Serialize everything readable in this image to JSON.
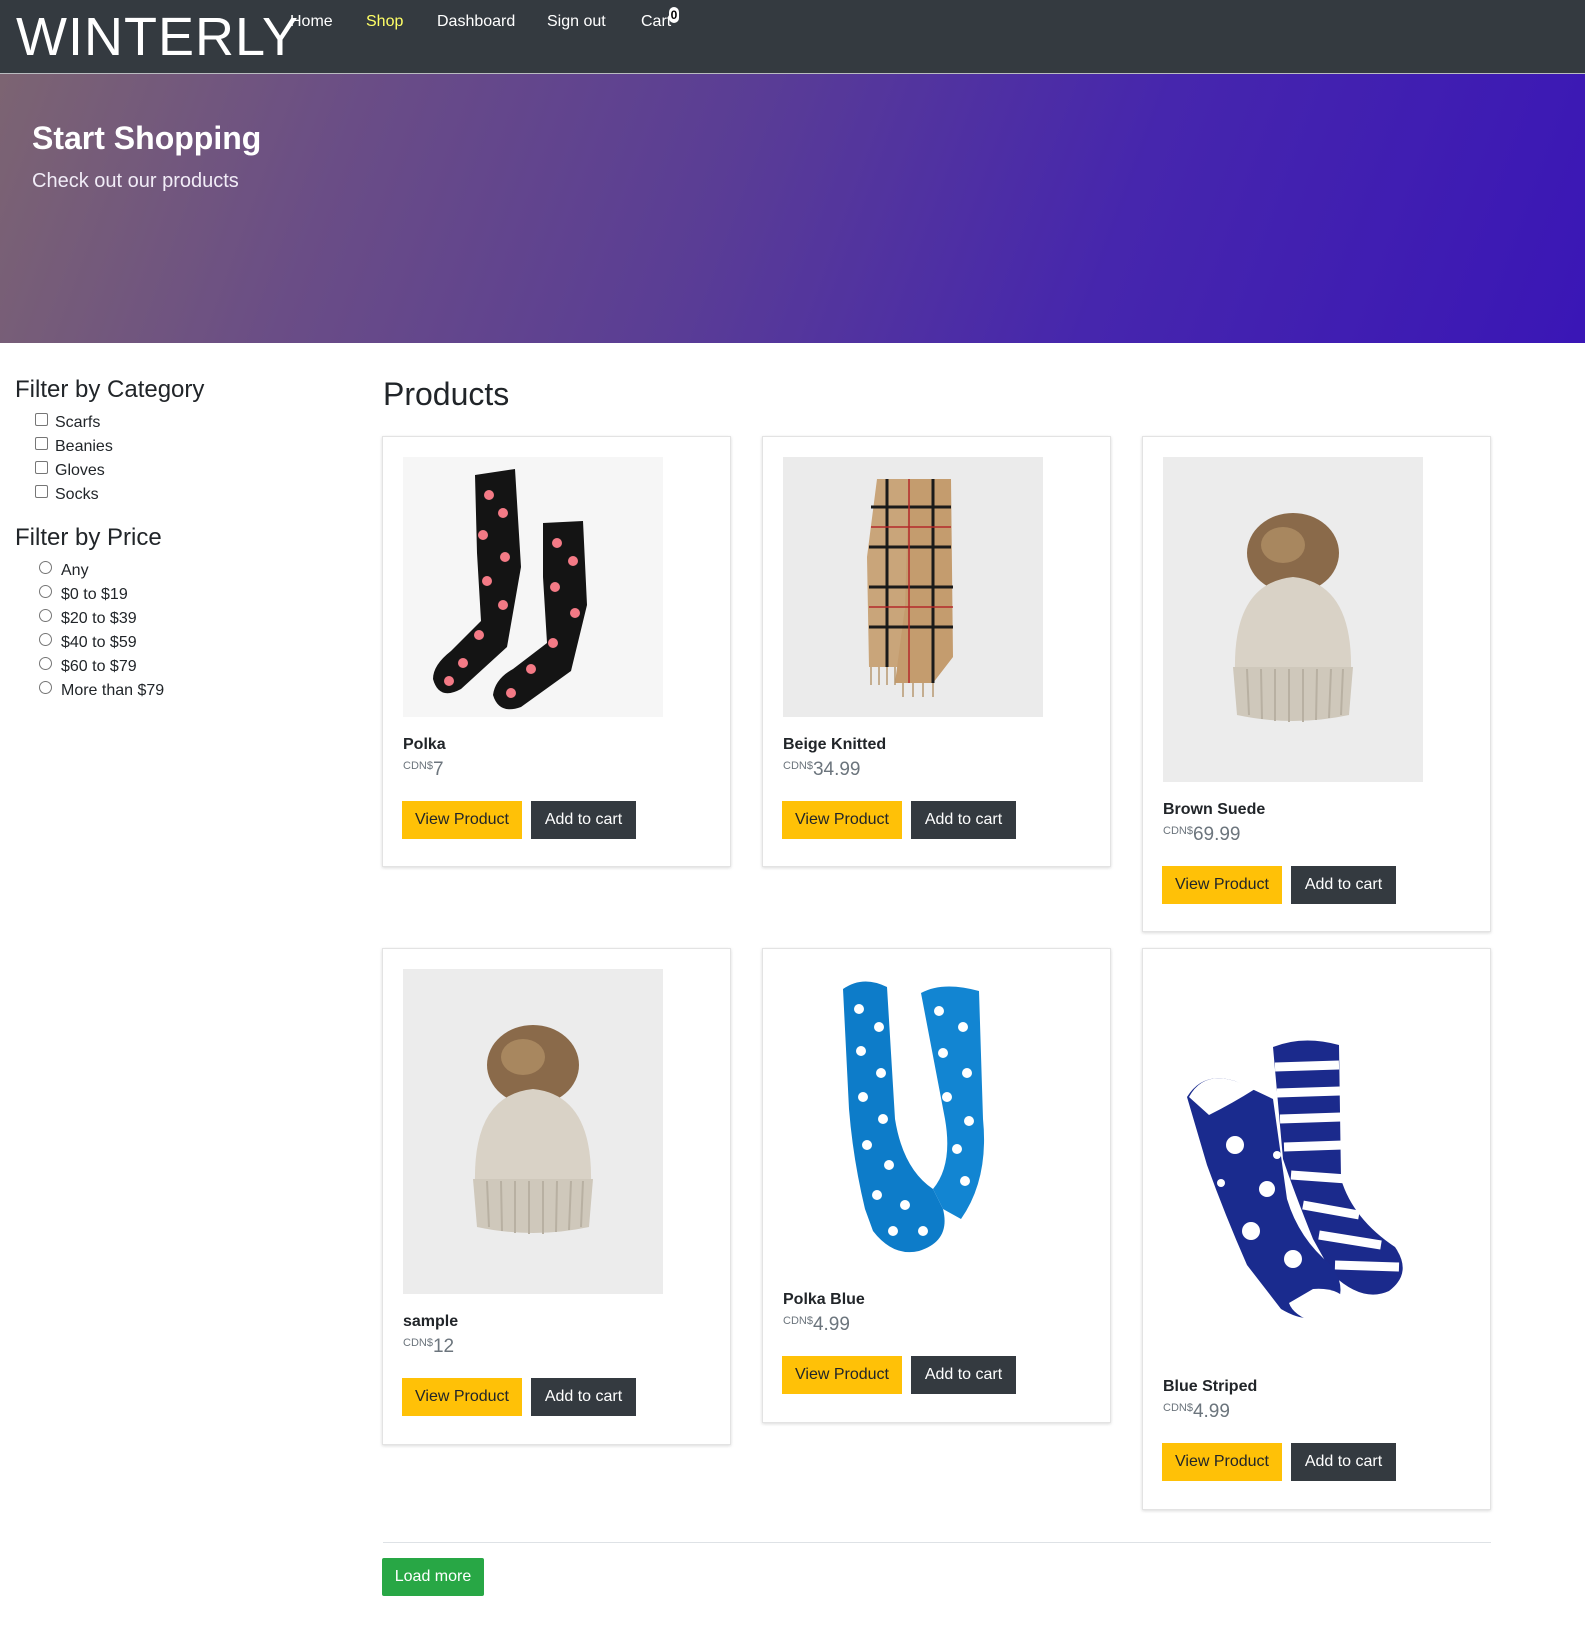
{
  "brand": "WINTERLY",
  "nav": {
    "home": "Home",
    "shop": "Shop",
    "dashboard": "Dashboard",
    "signout": "Sign out",
    "cart": "Cart",
    "cart_count": "0"
  },
  "hero": {
    "title": "Start Shopping",
    "subtitle": "Check out our products"
  },
  "filters": {
    "category_title": "Filter by Category",
    "categories": [
      "Scarfs",
      "Beanies",
      "Gloves",
      "Socks"
    ],
    "price_title": "Filter by Price",
    "prices": [
      "Any",
      "$0 to $19",
      "$20 to $39",
      "$40 to $59",
      "$60 to $79",
      "More than $79"
    ]
  },
  "products_title": "Products",
  "currency": "CDN$",
  "products": [
    {
      "name": "Polka",
      "price": "7",
      "view_label": "View Product",
      "cart_label": "Add to cart"
    },
    {
      "name": "Beige Knitted",
      "price": "34.99",
      "view_label": "View Product",
      "cart_label": "Add to cart"
    },
    {
      "name": "Brown Suede",
      "price": "69.99",
      "view_label": "View Product",
      "cart_label": "Add to cart"
    },
    {
      "name": "sample",
      "price": "12",
      "view_label": "View Product",
      "cart_label": "Add to cart"
    },
    {
      "name": "Polka Blue",
      "price": "4.99",
      "view_label": "View Product",
      "cart_label": "Add to cart"
    },
    {
      "name": "Blue Striped",
      "price": "4.99",
      "view_label": "View Product",
      "cart_label": "Add to cart"
    }
  ],
  "load_more": "Load more",
  "colors": {
    "navbar": "#343a40",
    "active_nav": "#ffff66",
    "btn_yellow": "#ffc107",
    "btn_dark": "#343a40",
    "btn_green": "#28a745"
  }
}
